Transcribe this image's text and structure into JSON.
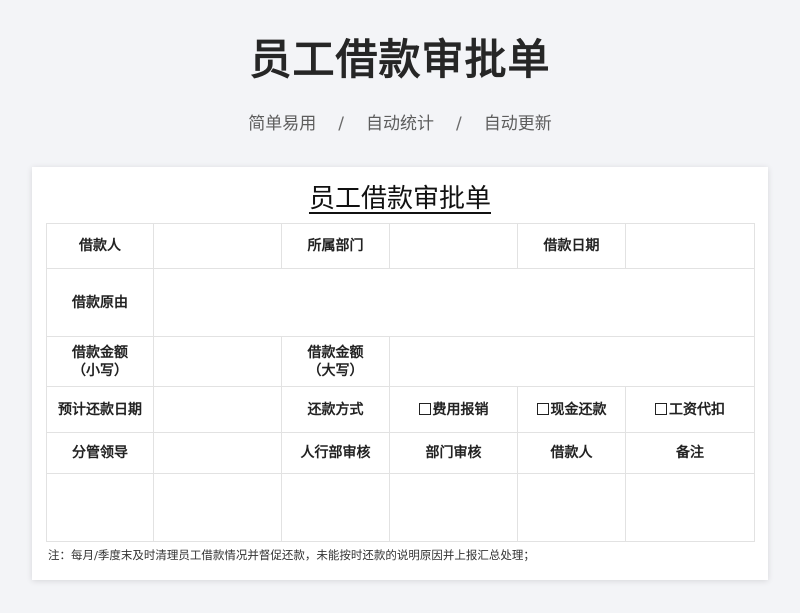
{
  "header": {
    "title": "员工借款审批单",
    "tags": [
      "简单易用",
      "自动统计",
      "自动更新"
    ],
    "separator": "/"
  },
  "form": {
    "title": "员工借款审批单",
    "labels": {
      "borrower": "借款人",
      "department": "所属部门",
      "loan_date": "借款日期",
      "reason": "借款原由",
      "amount_lower_1": "借款金额",
      "amount_lower_2": "（小写）",
      "amount_upper_1": "借款金额",
      "amount_upper_2": "（大写）",
      "expected_repay_date": "预计还款日期",
      "repay_method": "还款方式",
      "supervisor": "分管领导",
      "hr_review": "人行部审核",
      "dept_review": "部门审核",
      "borrower_sign": "借款人",
      "remarks": "备注"
    },
    "repay_options": [
      "费用报销",
      "现金还款",
      "工资代扣"
    ],
    "note": "注：每月/季度末及时清理员工借款情况并督促还款，未能按时还款的说明原因并上报汇总处理；"
  }
}
